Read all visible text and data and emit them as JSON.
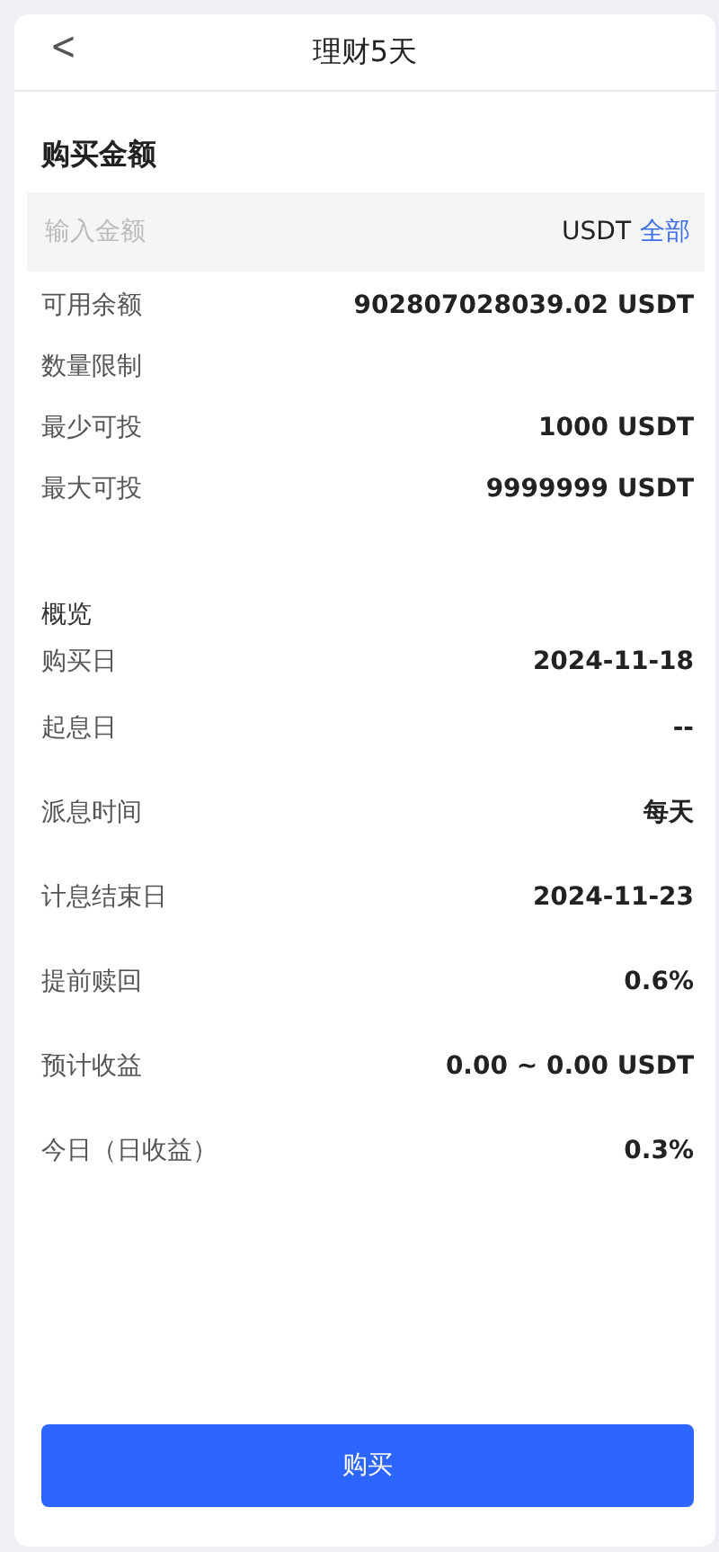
{
  "header": {
    "back": "<",
    "title": "理财5天"
  },
  "purchase": {
    "title": "购买金额",
    "input": {
      "placeholder": "输入金额",
      "unit": "USDT",
      "all_link": "全部"
    },
    "rows": [
      {
        "label": "可用余额",
        "value": "902807028039.02 USDT"
      },
      {
        "label": "数量限制"
      },
      {
        "label": "最少可投",
        "value": "1000 USDT"
      },
      {
        "label": "最大可投",
        "value": "9999999 USDT"
      }
    ]
  },
  "overview": {
    "title": "概览",
    "rows": [
      {
        "label": "购买日",
        "value": "2024-11-18"
      },
      {
        "label": "起息日",
        "value": "--"
      },
      {
        "label": "派息时间",
        "value": "每天"
      },
      {
        "label": "计息结束日",
        "value": "2024-11-23"
      },
      {
        "label": "提前赎回",
        "value": "0.6%"
      },
      {
        "label": "预计收益",
        "value": "0.00 ~ 0.00 USDT"
      },
      {
        "label": "今日（日收益）",
        "value": "0.3%"
      }
    ]
  },
  "buy_button": "购买"
}
